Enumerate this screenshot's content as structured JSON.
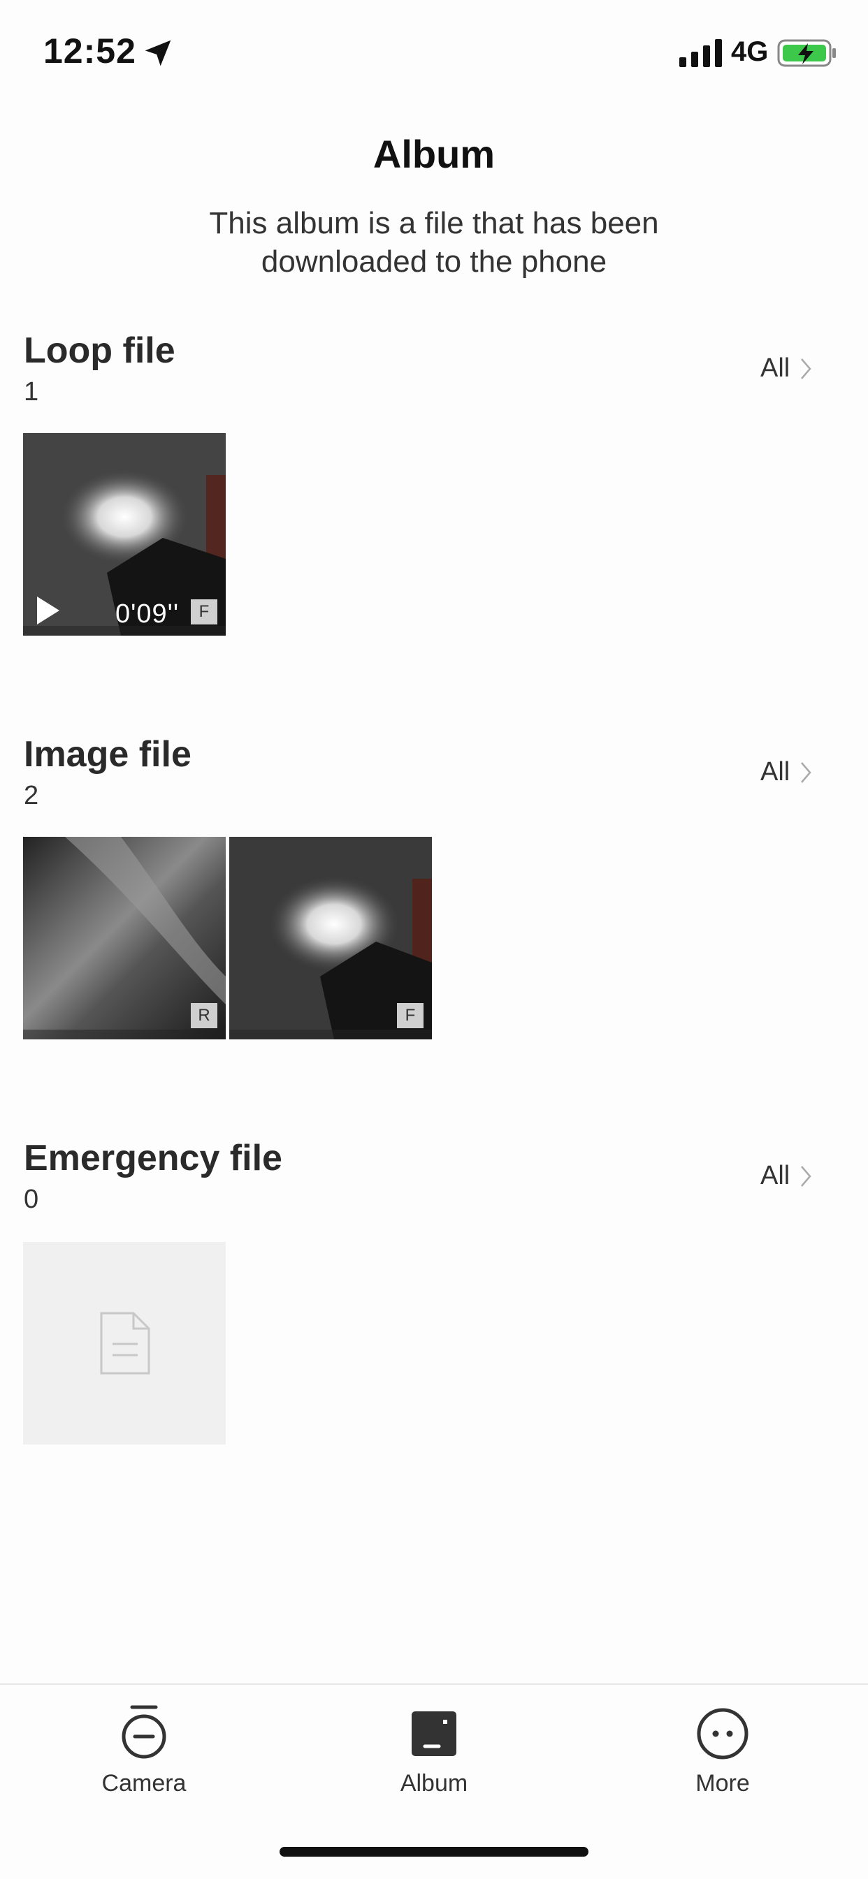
{
  "status_bar": {
    "time": "12:52",
    "network": "4G"
  },
  "header": {
    "title": "Album",
    "subtitle": "This album is a file that has been downloaded to the phone"
  },
  "sections": [
    {
      "title": "Loop file",
      "count": "1",
      "all_label": "All",
      "items": [
        {
          "type": "video",
          "duration": "0'09''",
          "tag": "F"
        }
      ]
    },
    {
      "title": "Image file",
      "count": "2",
      "all_label": "All",
      "items": [
        {
          "type": "image",
          "tag": "R"
        },
        {
          "type": "image",
          "tag": "F"
        }
      ]
    },
    {
      "title": "Emergency file",
      "count": "0",
      "all_label": "All",
      "items": [
        {
          "type": "placeholder",
          "icon": "document-icon"
        }
      ]
    }
  ],
  "tabbar": {
    "tabs": [
      {
        "label": "Camera",
        "icon": "camera-icon"
      },
      {
        "label": "Album",
        "icon": "album-icon",
        "active": true
      },
      {
        "label": "More",
        "icon": "more-icon"
      }
    ]
  },
  "colors": {
    "background": "#fdfdfd",
    "battery": "#3cc84a",
    "placeholder": "#f0f0f0"
  }
}
